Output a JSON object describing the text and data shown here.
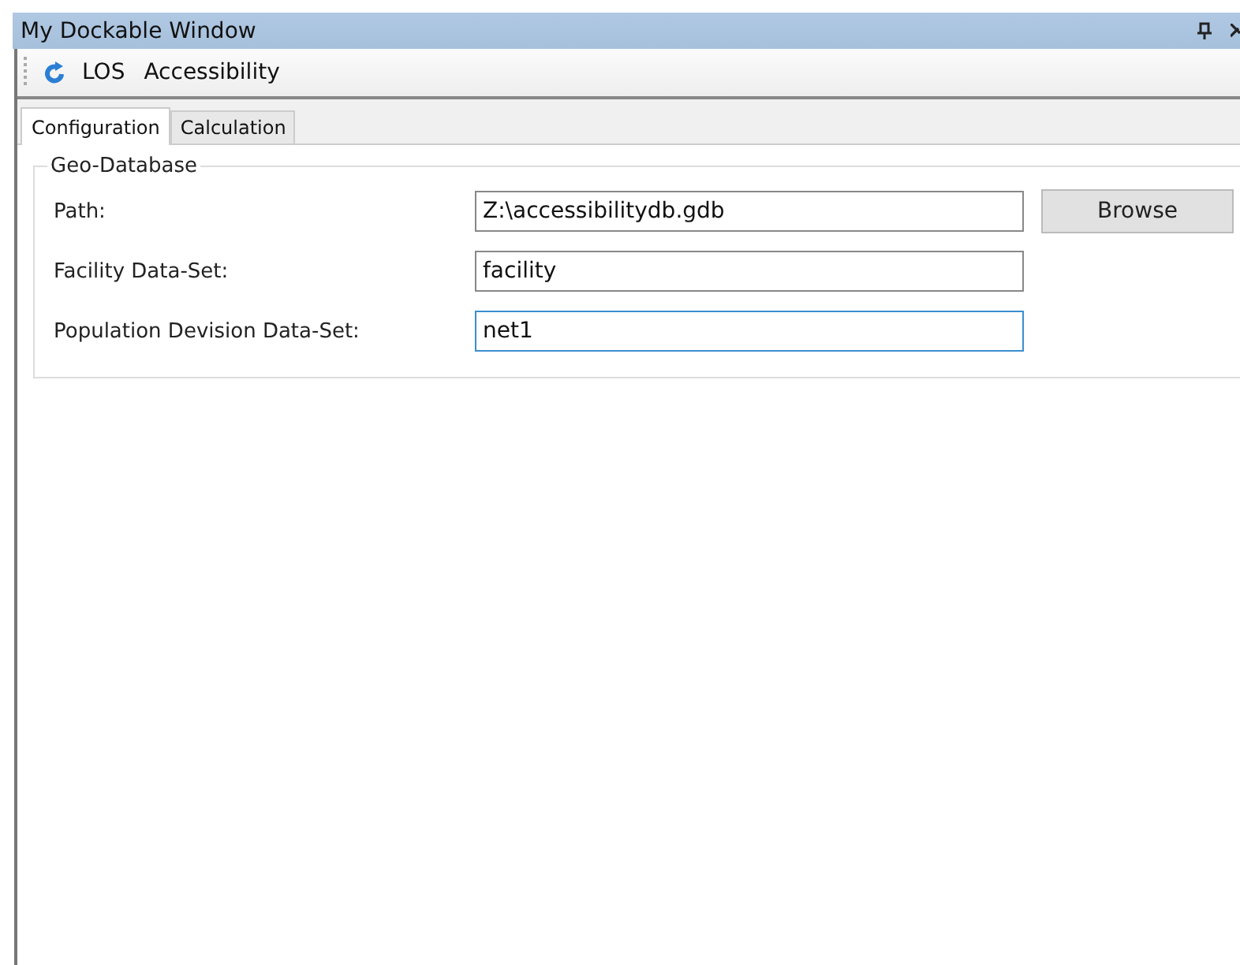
{
  "window": {
    "title": "My Dockable Window"
  },
  "toolbar": {
    "items": [
      "LOS",
      "Accessibility"
    ]
  },
  "tabs": [
    {
      "label": "Configuration",
      "selected": true
    },
    {
      "label": "Calculation",
      "selected": false
    }
  ],
  "group": {
    "title": "Geo-Database",
    "fields": [
      {
        "label": "Path:",
        "value": "Z:\\accessibilitydb.gdb",
        "focused": false
      },
      {
        "label": "Facility Data-Set:",
        "value": "facility",
        "focused": false
      },
      {
        "label": "Population Devision Data-Set:",
        "value": "net1",
        "focused": true
      }
    ],
    "button": "Browse"
  }
}
